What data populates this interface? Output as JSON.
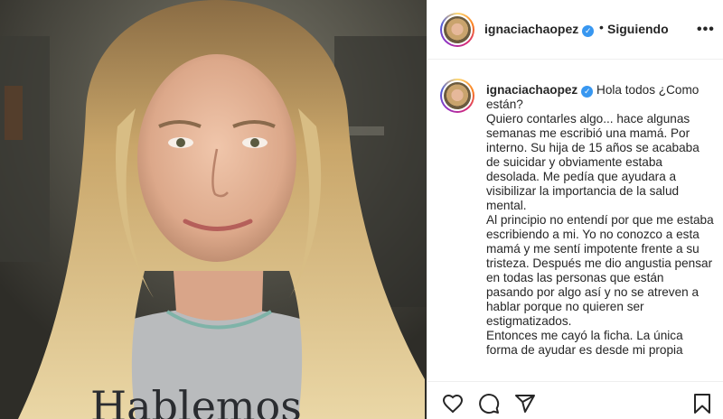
{
  "post": {
    "username": "ignaciachaopez",
    "verified_glyph": "✓",
    "separator": "•",
    "follow_status": "Siguiendo",
    "more_label": "•••",
    "caption_text": "Hola todos ¿Como están?\nQuiero contarles algo... hace algunas semanas me escribió una mamá. Por interno. Su hija de 15 años se acababa de suicidar y obviamente estaba desolada. Me pedía que ayudara a visibilizar la importancia de la salud mental.\nAl principio no entendí por que me estaba escribiendo a mi. Yo no conozco a esta mamá y me sentí impotente frente a su tristeza. Después me dio angustia pensar en todas las personas que están pasando por algo así y no se atreven a hablar porque no quieren ser estigmatizados.\nEntonces me cayó la ficha. La única forma de ayudar es desde mi propia"
  },
  "photo": {
    "shirt_text": "Hablemos"
  },
  "actions": {
    "icons": [
      "heart-icon",
      "comment-icon",
      "share-icon",
      "bookmark-icon"
    ]
  },
  "colors": {
    "verified": "#3897f0",
    "text": "#262626",
    "border": "#efefef"
  }
}
